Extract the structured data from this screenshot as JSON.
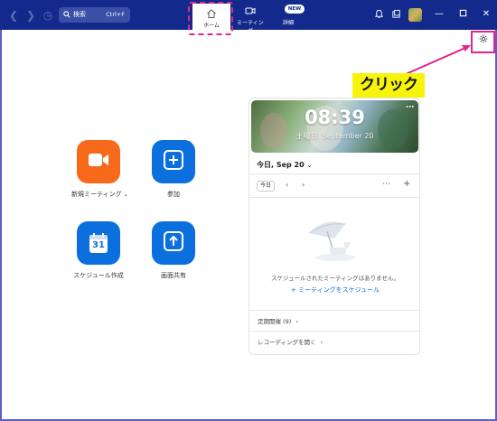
{
  "titlebar": {
    "search_label": "検索",
    "search_shortcut": "Ctrl+F",
    "tabs": [
      {
        "label": "ホーム",
        "icon": "home-icon"
      },
      {
        "label": "ミーティング",
        "icon": "video-icon"
      },
      {
        "label": "詳細",
        "icon": "more-icon",
        "badge": "NEW"
      }
    ]
  },
  "annotation": {
    "label": "クリック",
    "highlight_color": "#e2268a",
    "label_bg": "#f7f40c"
  },
  "actions": [
    {
      "label": "新規ミーティング",
      "color": "#f76a1c",
      "icon": "video-camera-icon",
      "has_dropdown": true
    },
    {
      "label": "参加",
      "color": "#0b6fde",
      "icon": "plus-icon"
    },
    {
      "label": "スケジュール作成",
      "color": "#0b6fde",
      "icon": "calendar-icon",
      "icon_text": "31"
    },
    {
      "label": "画面共有",
      "color": "#0b6fde",
      "icon": "share-screen-icon"
    }
  ],
  "calendar": {
    "time": "08:39",
    "date": "土曜日, September 20",
    "day_select": "今日, Sep 20",
    "today_button": "今日",
    "empty_text": "スケジュールされたミーティングはありません。",
    "schedule_link": "ミーティングをスケジュール",
    "recurring": "定期開催 (9)",
    "recordings": "レコーディングを開く"
  },
  "colors": {
    "titlebar": "#132a8c",
    "accent": "#0b6fde",
    "orange": "#f76a1c"
  }
}
